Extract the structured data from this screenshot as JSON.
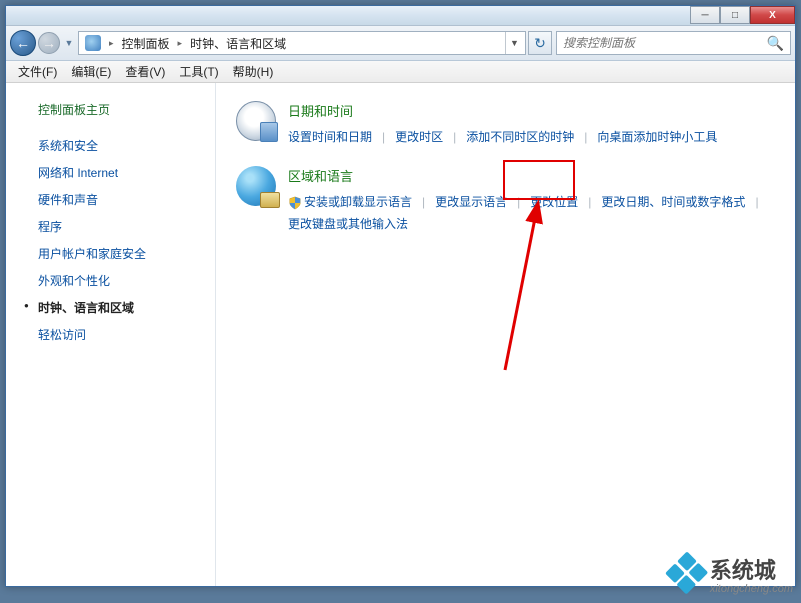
{
  "titlebar": {
    "minimize": "─",
    "maximize": "□",
    "close": "X"
  },
  "nav": {
    "back_arrow": "←",
    "forward_arrow": "→",
    "dropdown": "▼",
    "refresh": "↻"
  },
  "breadcrumb": {
    "arrow": "▸",
    "items": [
      "控制面板",
      "时钟、语言和区域"
    ]
  },
  "search": {
    "placeholder": "搜索控制面板",
    "icon": "🔍"
  },
  "menubar": [
    "文件(F)",
    "编辑(E)",
    "查看(V)",
    "工具(T)",
    "帮助(H)"
  ],
  "sidebar": {
    "home": "控制面板主页",
    "items": [
      {
        "label": "系统和安全",
        "current": false
      },
      {
        "label": "网络和 Internet",
        "current": false
      },
      {
        "label": "硬件和声音",
        "current": false
      },
      {
        "label": "程序",
        "current": false
      },
      {
        "label": "用户帐户和家庭安全",
        "current": false
      },
      {
        "label": "外观和个性化",
        "current": false
      },
      {
        "label": "时钟、语言和区域",
        "current": true
      },
      {
        "label": "轻松访问",
        "current": false
      }
    ]
  },
  "content": {
    "datetime": {
      "title": "日期和时间",
      "links": [
        "设置时间和日期",
        "更改时区",
        "添加不同时区的时钟",
        "向桌面添加时钟小工具"
      ]
    },
    "region": {
      "title": "区域和语言",
      "links": [
        "安装或卸载显示语言",
        "更改显示语言",
        "更改位置",
        "更改日期、时间或数字格式",
        "更改键盘或其他输入法"
      ]
    }
  },
  "separator": "|",
  "watermark": {
    "brand": "系统城",
    "url": "xitongcheng.com"
  }
}
